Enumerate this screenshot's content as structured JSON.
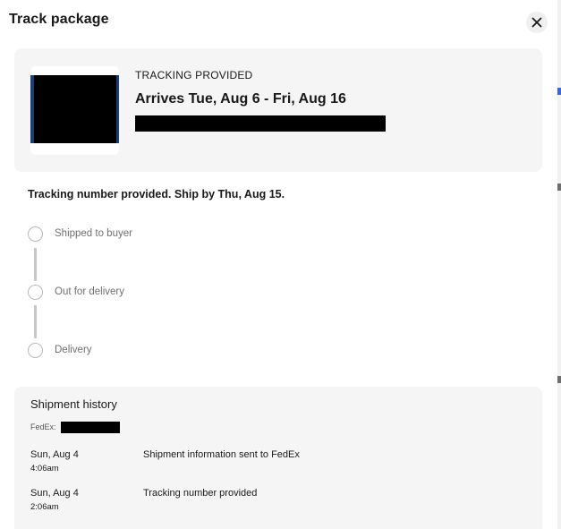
{
  "modal": {
    "title": "Track package",
    "close_icon": "close-icon"
  },
  "summary": {
    "status_label": "TRACKING PROVIDED",
    "arrival_text": "Arrives Tue, Aug 6 - Fri, Aug 16"
  },
  "tracking_note": "Tracking number provided. Ship by Thu, Aug 15.",
  "timeline": {
    "steps": [
      {
        "label": "Shipped to buyer"
      },
      {
        "label": "Out for delivery"
      },
      {
        "label": "Delivery"
      }
    ]
  },
  "history": {
    "heading": "Shipment history",
    "carrier_label": "FedEx:",
    "events": [
      {
        "date": "Sun, Aug 4",
        "time": "4:06am",
        "description": "Shipment information sent to FedEx"
      },
      {
        "date": "Sun, Aug 4",
        "time": "2:06am",
        "description": "Tracking number provided"
      }
    ]
  },
  "colors": {
    "card_background": "#f5f5f5",
    "step_circle": "#b9b9b9",
    "step_label": "#707070"
  }
}
